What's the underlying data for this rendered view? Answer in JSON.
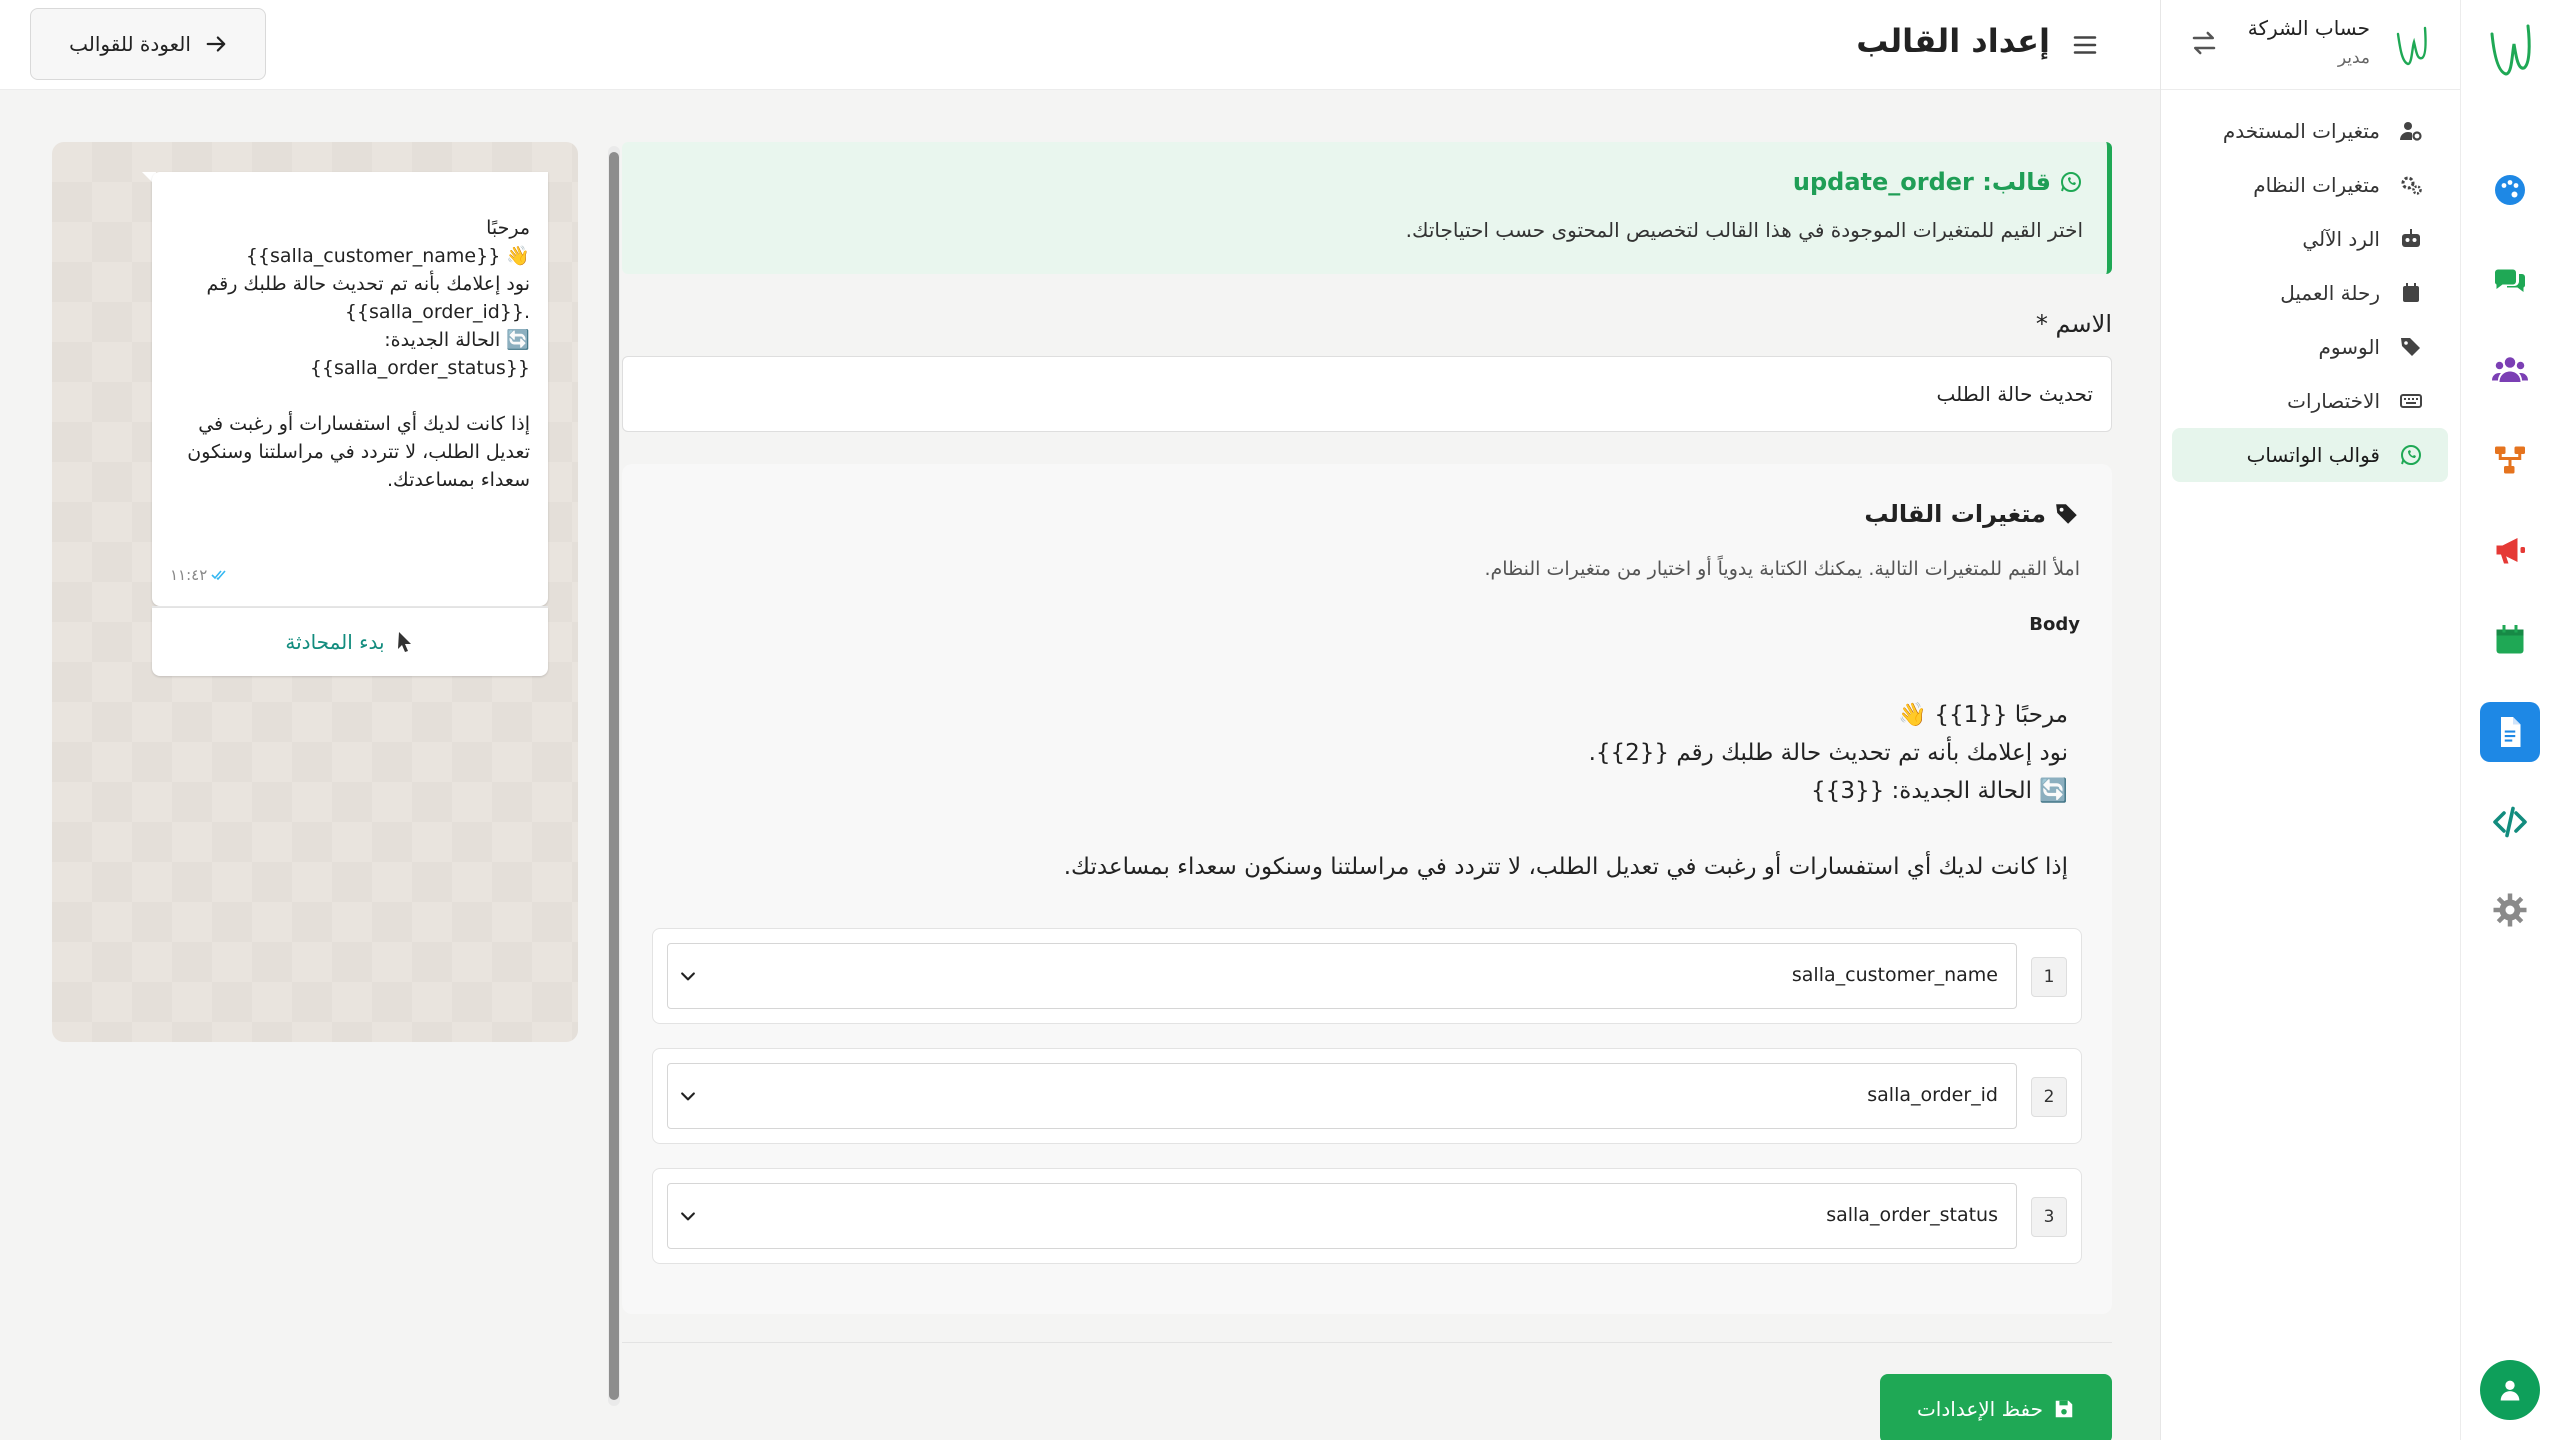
{
  "app": {
    "account_name": "حساب الشركة",
    "account_role": "مدير"
  },
  "header": {
    "page_title": "إعداد القالب",
    "back_label": "العودة للقوالب"
  },
  "sidebar": {
    "items": [
      {
        "label": "متغيرات المستخدم",
        "icon": "user-gear-icon"
      },
      {
        "label": "متغيرات النظام",
        "icon": "gears-icon"
      },
      {
        "label": "الرد الآلي",
        "icon": "robot-icon"
      },
      {
        "label": "رحلة العميل",
        "icon": "calendar-icon"
      },
      {
        "label": "الوسوم",
        "icon": "tags-icon"
      },
      {
        "label": "الاختصارات",
        "icon": "keyboard-icon"
      },
      {
        "label": "قوالب الواتساب",
        "icon": "whatsapp-icon",
        "active": true
      }
    ]
  },
  "rail": {
    "icons": [
      "palette-icon",
      "chat-icon",
      "users-icon",
      "flow-icon",
      "megaphone-icon",
      "calendar-icon",
      "document-icon",
      "code-icon",
      "settings-icon"
    ],
    "active": "document-icon",
    "colors": {
      "palette": "#1e88e5",
      "chat": "#1fa855",
      "users": "#7b3fb4",
      "flow": "#e5731e",
      "megaphone": "#e53935",
      "calendar": "#1fa855",
      "document": "#1e88e5",
      "code": "#128c7e",
      "settings": "#888888"
    }
  },
  "alert": {
    "title": "قالب: update_order",
    "description": "اختر القيم للمتغيرات الموجودة في هذا القالب لتخصيص المحتوى حسب احتياجاتك."
  },
  "form": {
    "name_label": "الاسم *",
    "name_value": "تحديث حالة الطلب"
  },
  "variables": {
    "title": "متغيرات القالب",
    "description": "املأ القيم للمتغيرات التالية. يمكنك الكتابة يدوياً أو اختيار من متغيرات النظام.",
    "body_label": "Body",
    "preview": "مرحبًا {{1}} 👋\nنود إعلامك بأنه تم تحديث حالة طلبك رقم {{2}}.\n🔄 الحالة الجديدة: {{3}}\n\nإذا كانت لديك أي استفسارات أو رغبت في تعديل الطلب، لا تتردد في مراسلتنا وسنكون سعداء بمساعدتك.",
    "rows": [
      {
        "num": "1",
        "value": "salla_customer_name"
      },
      {
        "num": "2",
        "value": "salla_order_id"
      },
      {
        "num": "3",
        "value": "salla_order_status"
      }
    ]
  },
  "save_label": "حفظ الإعدادات",
  "phone_preview": {
    "message": "مرحبًا\n👋 {{salla_customer_name}}\nنود إعلامك بأنه تم تحديث حالة طلبك رقم\n.{{salla_order_id}}\n🔄 الحالة الجديدة: {{salla_order_status}}\n\nإذا كانت لديك أي استفسارات أو رغبت في تعديل الطلب، لا تتردد في مراسلتنا وسنكون سعداء بمساعدتك.",
    "time": "١١:٤٢",
    "action_label": "بدء المحادثة"
  }
}
